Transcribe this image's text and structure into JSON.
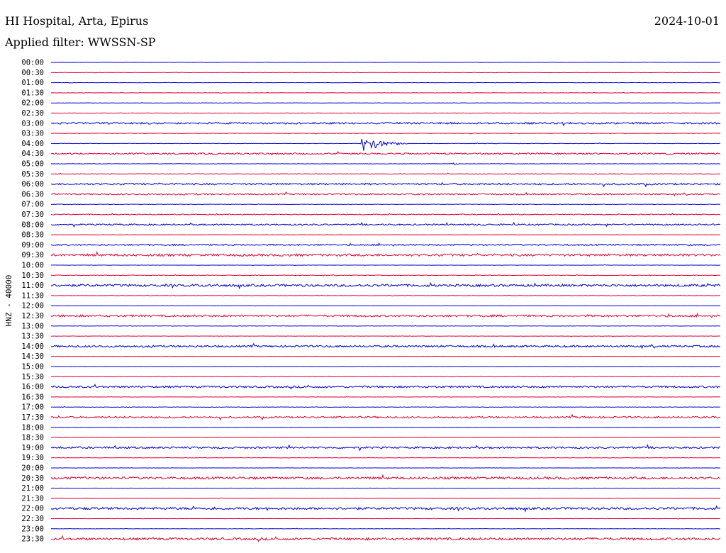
{
  "header": {
    "station": "HI Hospital, Arta, Epirus",
    "date": "2024-10-01",
    "filter": "Applied filter: WWSSN-SP"
  },
  "chart_data": {
    "type": "line",
    "title": "HI Hospital, Arta, Epirus",
    "subtitle": "Applied filter: WWSSN-SP",
    "ylabel": "HNZ - 40000",
    "row_labels": [
      "00:00",
      "00:30",
      "01:00",
      "01:30",
      "02:00",
      "02:30",
      "03:00",
      "03:30",
      "04:00",
      "04:30",
      "05:00",
      "05:30",
      "06:00",
      "06:30",
      "07:00",
      "07:30",
      "08:00",
      "08:30",
      "09:00",
      "09:30",
      "10:00",
      "10:30",
      "11:00",
      "11:30",
      "12:00",
      "12:30",
      "13:00",
      "13:30",
      "14:00",
      "14:30",
      "15:00",
      "15:30",
      "16:00",
      "16:30",
      "17:00",
      "17:30",
      "18:00",
      "18:30",
      "19:00",
      "19:30",
      "20:00",
      "20:30",
      "21:00",
      "21:30",
      "22:00",
      "22:30",
      "23:00",
      "23:30"
    ],
    "row_colors": [
      "#0000cc",
      "#dd0033"
    ],
    "noise_levels": [
      0.2,
      0.2,
      0.2,
      0.2,
      0.2,
      0.3,
      1.2,
      0.3,
      0.3,
      1.0,
      0.3,
      0.4,
      1.2,
      1.0,
      0.3,
      0.6,
      1.0,
      0.2,
      1.0,
      1.6,
      0.2,
      0.4,
      1.6,
      0.2,
      0.2,
      1.4,
      0.2,
      0.2,
      1.3,
      0.2,
      0.2,
      0.3,
      1.3,
      0.2,
      0.3,
      1.2,
      0.2,
      0.2,
      1.3,
      0.2,
      0.2,
      1.6,
      0.2,
      0.2,
      1.6,
      0.2,
      0.2,
      1.6
    ],
    "events": [
      {
        "row": "04:00",
        "minute": 14,
        "amplitude": 14,
        "duration_min": 2
      },
      {
        "row": "05:00",
        "minute": 18,
        "amplitude": 2,
        "duration_min": 0.5
      }
    ],
    "x_range_min": [
      0,
      30
    ],
    "grid": false
  }
}
